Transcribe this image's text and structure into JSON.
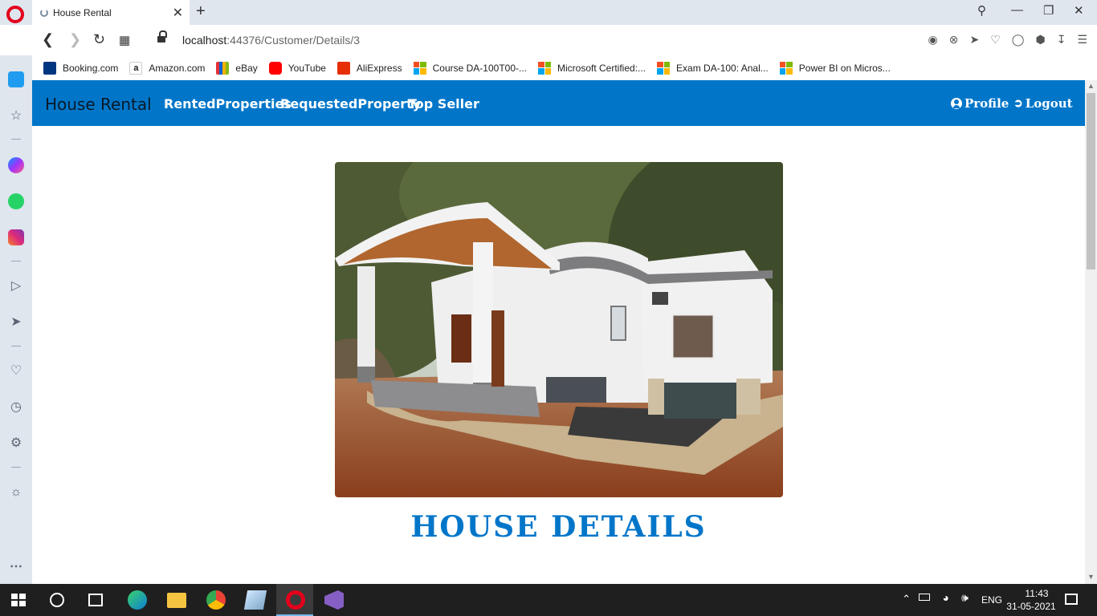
{
  "browser": {
    "tab_title": "House Rental",
    "url_host": "localhost",
    "url_path": ":44376/Customer/Details/3",
    "bookmarks": [
      {
        "label": "Booking.com",
        "color": "#003580"
      },
      {
        "label": "Amazon.com",
        "color": "#ffffff"
      },
      {
        "label": "eBay",
        "color": "#222222"
      },
      {
        "label": "YouTube",
        "color": "#ff0000"
      },
      {
        "label": "AliExpress",
        "color": "#e62e04"
      },
      {
        "label": "Course DA-100T00-...",
        "color": "ms"
      },
      {
        "label": "Microsoft Certified:...",
        "color": "ms"
      },
      {
        "label": "Exam DA-100: Anal...",
        "color": "ms"
      },
      {
        "label": "Power BI on Micros...",
        "color": "ms"
      }
    ]
  },
  "navbar": {
    "brand": "House Rental",
    "links": [
      "RentedProperties",
      "RequestedProperty",
      "Top Seller"
    ],
    "profile": "Profile",
    "logout": "Logout",
    "color": "#0176c9"
  },
  "main": {
    "image_icon": "house-photo",
    "title": "HOUSE DETAILS"
  },
  "taskbar": {
    "language": "ENG",
    "time": "11:43",
    "date": "31-05-2021"
  }
}
